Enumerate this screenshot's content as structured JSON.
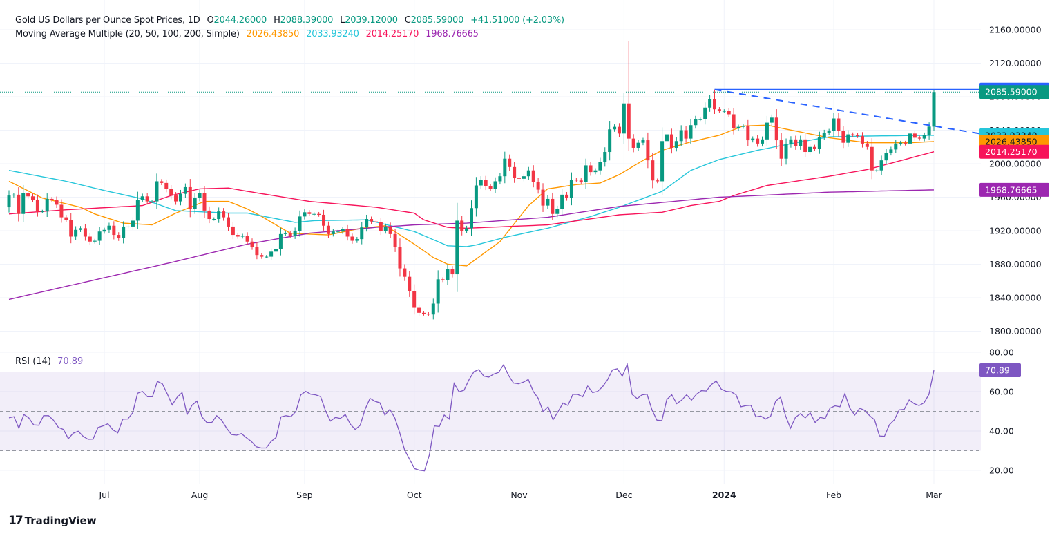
{
  "header": {
    "title": "Gold US Dollars per Ounce Spot Prices, 1D",
    "o_label": "O",
    "o_value": "2044.26000",
    "h_label": "H",
    "h_value": "2088.39000",
    "l_label": "L",
    "l_value": "2039.12000",
    "c_label": "C",
    "c_value": "2085.59000",
    "change": "+41.51000 (+2.03%)",
    "ma_title": "Moving Average Multiple (20, 50, 100, 200, Simple)",
    "ma20_value": "2026.43850",
    "ma50_value": "2033.93240",
    "ma100_value": "2014.25170",
    "ma200_value": "1968.76665"
  },
  "rsi_legend": {
    "title": "RSI (14)",
    "value": "70.89"
  },
  "branding": {
    "logo_mark": "17",
    "logo_text": "TradingView"
  },
  "colors": {
    "up": "#089981",
    "down": "#f23645",
    "ma20": "#ff9800",
    "ma50": "#26c6da",
    "ma100": "#f7135a",
    "ma200": "#9c27b0",
    "rsi": "#7e57c2",
    "trendline": "#2962ff",
    "text": "#131722"
  },
  "chart_data": [
    {
      "type": "candlestick",
      "title": "Gold US Dollars per Ounce Spot Prices, 1D",
      "first_date": "2023-06-05",
      "last_date": "2024-03-01",
      "first_open": 1948,
      "closes": [
        1962,
        1963,
        1940,
        1965,
        1961,
        1957,
        1943,
        1943,
        1958,
        1957,
        1951,
        1936,
        1933,
        1913,
        1921,
        1923,
        1913,
        1907,
        1908,
        1919,
        1921,
        1926,
        1915,
        1911,
        1925,
        1925,
        1932,
        1957,
        1961,
        1955,
        1955,
        1979,
        1977,
        1970,
        1962,
        1955,
        1964,
        1972,
        1946,
        1959,
        1965,
        1944,
        1934,
        1934,
        1943,
        1936,
        1925,
        1915,
        1913,
        1914,
        1907,
        1901,
        1891,
        1889,
        1889,
        1895,
        1898,
        1916,
        1917,
        1914,
        1920,
        1937,
        1942,
        1940,
        1940,
        1939,
        1926,
        1916,
        1919,
        1919,
        1922,
        1913,
        1908,
        1910,
        1924,
        1934,
        1931,
        1930,
        1920,
        1925,
        1916,
        1901,
        1875,
        1865,
        1848,
        1828,
        1822,
        1821,
        1820,
        1833,
        1862,
        1861,
        1874,
        1868,
        1932,
        1920,
        1923,
        1947,
        1974,
        1981,
        1973,
        1970,
        1979,
        1985,
        2006,
        1996,
        1983,
        1982,
        1985,
        1992,
        1978,
        1969,
        1950,
        1958,
        1940,
        1946,
        1963,
        1959,
        1981,
        1980,
        1978,
        1998,
        1990,
        1992,
        2002,
        2014,
        2041,
        2044,
        2036,
        2072,
        2030,
        2019,
        2025,
        2028,
        2004,
        1980,
        1979,
        2027,
        2035,
        2019,
        2027,
        2040,
        2030,
        2046,
        2053,
        2053,
        2067,
        2077,
        2065,
        2063,
        2063,
        2059,
        2042,
        2044,
        2045,
        2028,
        2030,
        2024,
        2029,
        2049,
        2055,
        2028,
        2006,
        2023,
        2029,
        2021,
        2029,
        2014,
        2020,
        2018,
        2032,
        2037,
        2039,
        2054,
        2039,
        2025,
        2035,
        2034,
        2033,
        2024,
        2020,
        1992,
        1992,
        2004,
        2013,
        2017,
        2024,
        2025,
        2024,
        2036,
        2031,
        2030,
        2034,
        2044.26,
        2085.59
      ],
      "notable_highs": {
        "2023-12-04": 2146,
        "2023-12-28": 2088.5,
        "2024-03-01": 2088.39
      },
      "notable_lows": {
        "2024-03-01": 2039.12
      },
      "last_candle": {
        "open": 2044.26,
        "high": 2088.39,
        "low": 2039.12,
        "close": 2085.59
      },
      "moving_averages": [
        {
          "name": "20",
          "color_key": "ma20",
          "last": 2026.4385,
          "points": [
            [
              "2023-06-05",
              1979
            ],
            [
              "2023-06-14",
              1959
            ],
            [
              "2023-06-26",
              1948
            ],
            [
              "2023-06-29",
              1940
            ],
            [
              "2023-07-07",
              1929
            ],
            [
              "2023-07-17",
              1927
            ],
            [
              "2023-07-24",
              1941
            ],
            [
              "2023-08-01",
              1955
            ],
            [
              "2023-08-08",
              1955
            ],
            [
              "2023-08-14",
              1946
            ],
            [
              "2023-08-17",
              1937
            ],
            [
              "2023-08-25",
              1917
            ],
            [
              "2023-09-06",
              1915
            ],
            [
              "2023-09-15",
              1923
            ],
            [
              "2023-09-22",
              1926
            ],
            [
              "2023-10-02",
              1904
            ],
            [
              "2023-10-06",
              1888
            ],
            [
              "2023-10-11",
              1880
            ],
            [
              "2023-10-17",
              1878
            ],
            [
              "2023-10-26",
              1907
            ],
            [
              "2023-11-03",
              1950
            ],
            [
              "2023-11-09",
              1970
            ],
            [
              "2023-11-17",
              1975
            ],
            [
              "2023-11-24",
              1977
            ],
            [
              "2023-11-30",
              1987
            ],
            [
              "2023-12-07",
              2004
            ],
            [
              "2023-12-13",
              2016
            ],
            [
              "2023-12-21",
              2026
            ],
            [
              "2023-12-29",
              2034
            ],
            [
              "2024-01-05",
              2045
            ],
            [
              "2024-01-12",
              2046
            ],
            [
              "2024-01-22",
              2039
            ],
            [
              "2024-01-31",
              2031
            ],
            [
              "2024-02-12",
              2025
            ],
            [
              "2024-02-23",
              2025
            ],
            [
              "2024-03-01",
              2026.4385
            ]
          ]
        },
        {
          "name": "50",
          "color_key": "ma50",
          "last": 2033.9324,
          "points": [
            [
              "2023-06-05",
              1992
            ],
            [
              "2023-06-21",
              1979
            ],
            [
              "2023-07-03",
              1968
            ],
            [
              "2023-07-13",
              1958
            ],
            [
              "2023-07-24",
              1944
            ],
            [
              "2023-08-08",
              1941
            ],
            [
              "2023-08-14",
              1941
            ],
            [
              "2023-08-28",
              1930
            ],
            [
              "2023-09-01",
              1932
            ],
            [
              "2023-09-18",
              1933
            ],
            [
              "2023-09-25",
              1926
            ],
            [
              "2023-10-02",
              1919
            ],
            [
              "2023-10-11",
              1902
            ],
            [
              "2023-10-17",
              1901
            ],
            [
              "2023-10-19",
              1903
            ],
            [
              "2023-10-27",
              1912
            ],
            [
              "2023-11-09",
              1923
            ],
            [
              "2023-11-22",
              1937
            ],
            [
              "2023-11-30",
              1948
            ],
            [
              "2023-12-13",
              1967
            ],
            [
              "2023-12-21",
              1992
            ],
            [
              "2023-12-29",
              2005
            ],
            [
              "2024-01-10",
              2016
            ],
            [
              "2024-01-22",
              2025
            ],
            [
              "2024-01-31",
              2032
            ],
            [
              "2024-02-12",
              2033
            ],
            [
              "2024-03-01",
              2033.9324
            ]
          ]
        },
        {
          "name": "100",
          "color_key": "ma100",
          "last": 2014.2517,
          "points": [
            [
              "2023-06-05",
              1940
            ],
            [
              "2023-06-21",
              1945
            ],
            [
              "2023-07-13",
              1950
            ],
            [
              "2023-07-21",
              1962
            ],
            [
              "2023-07-31",
              1970
            ],
            [
              "2023-08-08",
              1971
            ],
            [
              "2023-08-14",
              1967
            ],
            [
              "2023-08-31",
              1955
            ],
            [
              "2023-09-20",
              1948
            ],
            [
              "2023-10-02",
              1941
            ],
            [
              "2023-10-04",
              1933
            ],
            [
              "2023-10-11",
              1924
            ],
            [
              "2023-10-17",
              1923
            ],
            [
              "2023-11-09",
              1927
            ],
            [
              "2023-11-30",
              1939
            ],
            [
              "2023-12-13",
              1942
            ],
            [
              "2023-12-21",
              1950
            ],
            [
              "2023-12-29",
              1955
            ],
            [
              "2024-01-03",
              1962
            ],
            [
              "2024-01-12",
              1974
            ],
            [
              "2024-01-31",
              1985
            ],
            [
              "2024-02-12",
              1993
            ],
            [
              "2024-03-01",
              2014.2517
            ]
          ]
        },
        {
          "name": "200",
          "color_key": "ma200",
          "last": 1968.76665,
          "points": [
            [
              "2023-06-05",
              1838
            ],
            [
              "2023-07-21",
              1882
            ],
            [
              "2023-08-14",
              1904
            ],
            [
              "2023-08-31",
              1917
            ],
            [
              "2023-09-20",
              1924
            ],
            [
              "2023-10-02",
              1927
            ],
            [
              "2023-10-17",
              1929
            ],
            [
              "2023-11-09",
              1936
            ],
            [
              "2023-11-30",
              1949
            ],
            [
              "2023-12-29",
              1960
            ],
            [
              "2024-01-10",
              1962
            ],
            [
              "2024-01-31",
              1966
            ],
            [
              "2024-03-01",
              1968.76665
            ]
          ]
        }
      ],
      "horizontal_line": {
        "from_date": "2023-12-28",
        "price": 2088.5,
        "label": "2088.50000"
      },
      "descending_trendline": {
        "from": [
          "2023-12-28",
          2088.5
        ],
        "to": [
          "2024-03-01",
          2045
        ],
        "style": "dashed",
        "extended": true
      },
      "last_price_line": {
        "price": 2085.59,
        "label": "2085.59000",
        "style": "dotted"
      },
      "price_tags": [
        {
          "label": "2088.50000",
          "price": 2088.5,
          "color_key": "trendline"
        },
        {
          "label": "2085.59000",
          "price": 2085.59,
          "color_key": "up"
        },
        {
          "label": "2033.93240",
          "price": 2033.9324,
          "color_key": "ma50"
        },
        {
          "label": "2026.43850",
          "price": 2026.4385,
          "color_key": "ma20"
        },
        {
          "label": "2014.25170",
          "price": 2014.2517,
          "color_key": "ma100"
        },
        {
          "label": "1968.76665",
          "price": 1968.76665,
          "color_key": "ma200"
        }
      ],
      "y_ticks": [
        "2160.00000",
        "2120.00000",
        "2080.00000",
        "2040.00000",
        "2000.00000",
        "1960.00000",
        "1920.00000",
        "1880.00000",
        "1840.00000",
        "1800.00000"
      ],
      "ylim": [
        1780,
        2175
      ],
      "x_ticks": [
        {
          "label": "Jul",
          "date": "2023-07-03"
        },
        {
          "label": "Aug",
          "date": "2023-07-31"
        },
        {
          "label": "Sep",
          "date": "2023-08-30"
        },
        {
          "label": "Oct",
          "date": "2023-10-02"
        },
        {
          "label": "Nov",
          "date": "2023-11-01"
        },
        {
          "label": "Dec",
          "date": "2023-12-01"
        },
        {
          "label": "2024",
          "date": "2024-01-01",
          "bold": true
        },
        {
          "label": "Feb",
          "date": "2024-02-01"
        },
        {
          "label": "Mar",
          "date": "2024-03-01"
        }
      ],
      "grid": true
    },
    {
      "type": "line",
      "title": "RSI (14)",
      "last_value": 70.89,
      "ylim": [
        15,
        80
      ],
      "y_ticks": [
        "80.00",
        "60.00",
        "40.00",
        "20.00"
      ],
      "bands": [
        70,
        50,
        30
      ],
      "values": [
        46.7,
        47.3,
        41.4,
        48.4,
        46.7,
        43.1,
        42.9,
        47.8,
        47.8,
        45.5,
        41.8,
        40.8,
        36.1,
        38.9,
        39.9,
        37.3,
        35.8,
        35.9,
        41.8,
        42.6,
        43.7,
        40.6,
        39.1,
        46.0,
        46.1,
        49.2,
        59.2,
        60.1,
        57.4,
        57.4,
        65.2,
        64.0,
        58.9,
        53.3,
        57.2,
        59.5,
        48.4,
        53.1,
        55.2,
        47.2,
        44.3,
        44.3,
        47.8,
        45.5,
        41.4,
        38.2,
        37.9,
        38.7,
        36.6,
        34.7,
        32.0,
        31.4,
        31.4,
        34.7,
        36.7,
        47.2,
        47.8,
        47.3,
        49.9,
        58.4,
        60.1,
        58.7,
        58.4,
        57.5,
        50.2,
        45.1,
        46.9,
        46.4,
        48.4,
        43.5,
        40.8,
        42.9,
        51.1,
        56.6,
        55.1,
        54.3,
        48.1,
        51.0,
        46.7,
        39.1,
        30.3,
        25.6,
        20.9,
        20.1,
        19.8,
        27.9,
        42.6,
        42.3,
        48.1,
        46.1,
        64.2,
        59.9,
        60.7,
        66.0,
        70.1,
        71.2,
        67.9,
        67.4,
        68.9,
        69.8,
        73.6,
        68.3,
        64.4,
        64.0,
        64.8,
        66.2,
        60.1,
        56.6,
        49.9,
        52.3,
        45.7,
        49.8,
        54.2,
        53.0,
        58.6,
        58.6,
        57.4,
        62.8,
        59.5,
        60.1,
        62.5,
        66.0,
        71.0,
        71.6,
        67.9,
        73.9,
        58.6,
        56.5,
        58.4,
        58.7,
        50.7,
        45.5,
        45.3,
        56.0,
        58.4,
        53.9,
        55.7,
        58.4,
        55.7,
        58.7,
        60.5,
        60.3,
        63.6,
        65.4,
        61.3,
        60.1,
        59.9,
        58.4,
        52.3,
        52.9,
        53.1,
        47.2,
        47.6,
        46.1,
        47.6,
        55.2,
        57.2,
        47.8,
        41.4,
        46.9,
        48.8,
        46.7,
        49.2,
        44.3,
        46.9,
        46.4,
        51.6,
        52.8,
        52.3,
        59.0,
        51.6,
        48.1,
        51.6,
        50.5,
        47.8,
        45.7,
        37.5,
        37.3,
        43.2,
        45.7,
        50.8,
        51.0,
        55.8,
        53.9,
        52.9,
        54.3,
        58.6,
        70.89
      ],
      "tag": {
        "label": "70.89",
        "color_key": "rsi"
      }
    }
  ]
}
